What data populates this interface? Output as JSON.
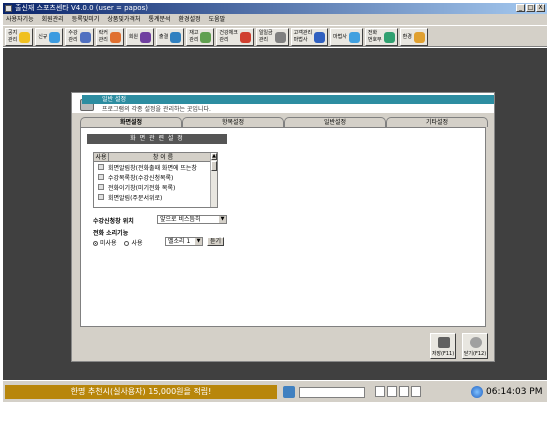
{
  "window": {
    "title": "출신재 스포츠센타 V4.0.0 (user = papos)",
    "controls": [
      "_",
      "□",
      "X"
    ]
  },
  "menu": [
    "사용자기능",
    "회원관리",
    "등록및미기",
    "상품및가격처",
    "통계분석",
    "환경설정",
    "도움말"
  ],
  "toolbar": [
    {
      "label": "공지\n관리",
      "icon": "notice-icon",
      "color": "#f0c020"
    },
    {
      "label": "신규",
      "icon": "new-member-icon",
      "color": "#3c9be0"
    },
    {
      "label": "수강\n관리",
      "icon": "class-icon",
      "color": "#5070c0"
    },
    {
      "label": "락커\n관리",
      "icon": "locker-icon",
      "color": "#e07030"
    },
    {
      "label": "회원",
      "icon": "members-icon",
      "color": "#7040a0"
    },
    {
      "label": "출결",
      "icon": "attendance-icon",
      "color": "#3080c0"
    },
    {
      "label": "재고\n관리",
      "icon": "inventory-icon",
      "color": "#60a050"
    },
    {
      "label": "건강체크\n관리",
      "icon": "health-icon",
      "color": "#d04030"
    },
    {
      "label": "일일금\n관리",
      "icon": "daily-icon",
      "color": "#808080"
    },
    {
      "label": "고객관리\n마법사",
      "icon": "wizard-icon",
      "color": "#3060c0"
    },
    {
      "label": "마법사",
      "icon": "magic-icon",
      "color": "#40a0e0"
    },
    {
      "label": "전화\n번호부",
      "icon": "phonebook-icon",
      "color": "#30a070"
    },
    {
      "label": "환경",
      "icon": "settings-icon",
      "color": "#e0a030"
    }
  ],
  "dialog": {
    "header": "일반 설정",
    "subtitle": "프로그램의 각종 설정을 관리하는 곳입니다.",
    "tabs": [
      "화면설정",
      "항목설정",
      "일반설정",
      "기타설정"
    ],
    "section": "화 면 관 련 설 정",
    "list_headers": [
      "사용",
      "창 이 름"
    ],
    "list_items": [
      "회면알림창(전화출때 화면에 뜨는창",
      "수강목록창(수강신청목록)",
      "전화이기창(미기전화 목록)",
      "회면알림(주문서위로)"
    ],
    "class_position_label": "수강신청창 위치",
    "class_position_value": "앞으로 비스듬히",
    "phone_sound_label": "전화 소리기능",
    "radio_off": "미사용",
    "radio_on": "사용",
    "sound_select": "벨소리 1",
    "listen_button": "듣기",
    "save_button": "저장(F11)",
    "close_button": "닫기(F12)"
  },
  "status": {
    "promo": "한명 추천시(실사용자) 15,000원을 적립!",
    "time": "06:14:03 PM"
  }
}
